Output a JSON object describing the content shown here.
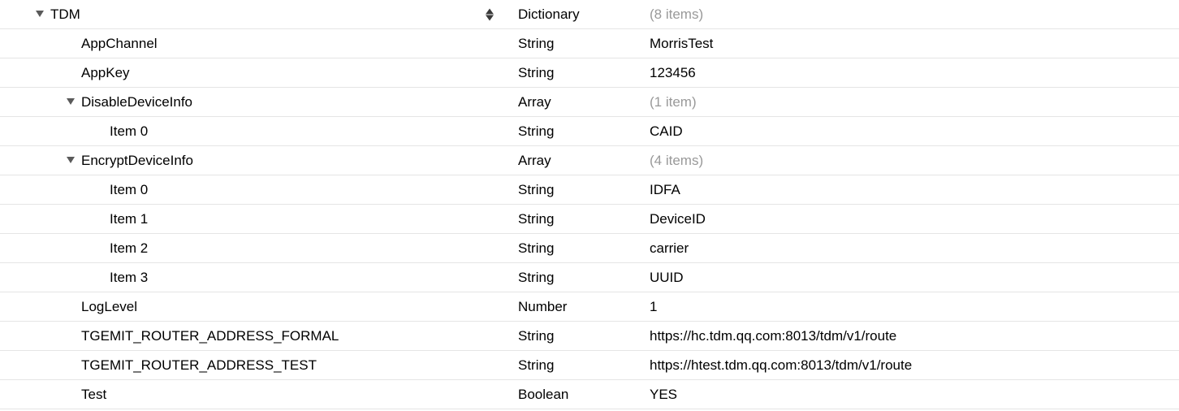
{
  "rows": [
    {
      "key": "TDM",
      "type": "Dictionary",
      "value": "(8 items)",
      "indent": 0,
      "disclosure": true,
      "muted": true,
      "selected": true
    },
    {
      "key": "AppChannel",
      "type": "String",
      "value": "MorrisTest",
      "indent": 1
    },
    {
      "key": "AppKey",
      "type": "String",
      "value": "123456",
      "indent": 1
    },
    {
      "key": "DisableDeviceInfo",
      "type": "Array",
      "value": "(1 item)",
      "indent": 1,
      "disclosure": true,
      "muted": true
    },
    {
      "key": "Item 0",
      "type": "String",
      "value": "CAID",
      "indent": 2
    },
    {
      "key": "EncryptDeviceInfo",
      "type": "Array",
      "value": "(4 items)",
      "indent": 1,
      "disclosure": true,
      "muted": true
    },
    {
      "key": "Item 0",
      "type": "String",
      "value": "IDFA",
      "indent": 2
    },
    {
      "key": "Item 1",
      "type": "String",
      "value": "DeviceID",
      "indent": 2
    },
    {
      "key": "Item 2",
      "type": "String",
      "value": "carrier",
      "indent": 2
    },
    {
      "key": "Item 3",
      "type": "String",
      "value": "UUID",
      "indent": 2
    },
    {
      "key": "LogLevel",
      "type": "Number",
      "value": "1",
      "indent": 1
    },
    {
      "key": "TGEMIT_ROUTER_ADDRESS_FORMAL",
      "type": "String",
      "value": "https://hc.tdm.qq.com:8013/tdm/v1/route",
      "indent": 1
    },
    {
      "key": "TGEMIT_ROUTER_ADDRESS_TEST",
      "type": "String",
      "value": "https://htest.tdm.qq.com:8013/tdm/v1/route",
      "indent": 1
    },
    {
      "key": "Test",
      "type": "Boolean",
      "value": "YES",
      "indent": 1
    }
  ]
}
